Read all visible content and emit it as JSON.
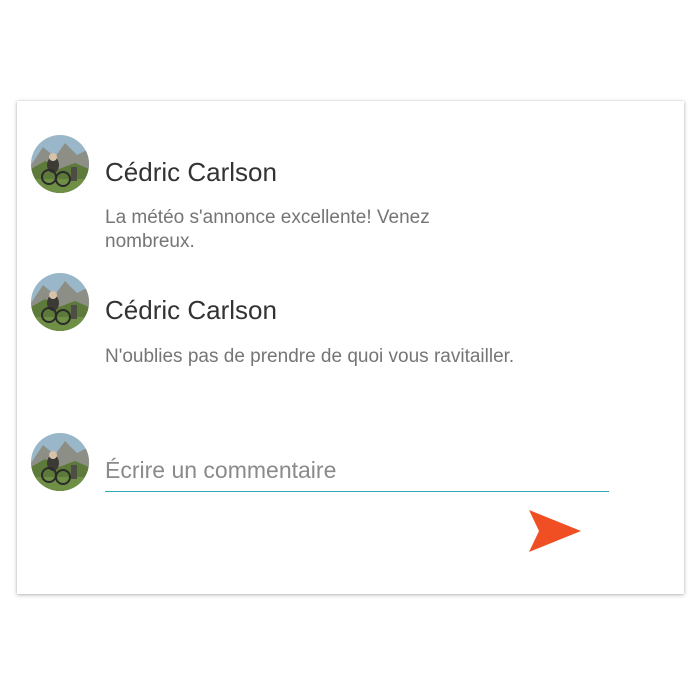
{
  "comments": [
    {
      "author": "Cédric Carlson",
      "text": "La météo s'annonce excellente! Venez nombreux."
    },
    {
      "author": "Cédric Carlson",
      "text": "N'oublies pas de prendre de quoi vous ravitailler."
    }
  ],
  "composer": {
    "placeholder": "Écrire un commentaire",
    "send_icon": "send-icon"
  },
  "colors": {
    "accent_underline": "#35aab0",
    "send_icon": "#f04e23",
    "author_text": "#333333",
    "comment_text": "#757575"
  }
}
